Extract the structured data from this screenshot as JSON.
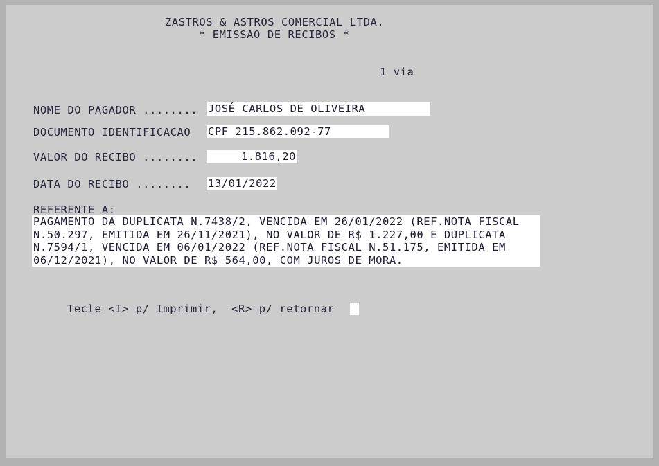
{
  "window": {
    "frame_color": "#b2b2b2",
    "screen_color": "#cccccc",
    "text_color": "#24243c",
    "field_background": "#ffffff"
  },
  "header": {
    "company_title": "ZASTROS & ASTROS COMERCIAL LTDA.",
    "screen_title": "* EMISSAO DE RECIBOS *",
    "via_label": "1 via"
  },
  "form": {
    "fields": [
      {
        "label": "NOME DO PAGADOR ........",
        "value": "JOSÉ CARLOS DE OLIVEIRA",
        "name": "nome-do-pagador"
      },
      {
        "label": "DOCUMENTO IDENTIFICACAO",
        "value": "CPF 215.862.092-77",
        "name": "documento-identificacao"
      },
      {
        "label": "VALOR DO RECIBO ........",
        "value": "1.816,20",
        "name": "valor-do-recibo"
      },
      {
        "label": "DATA DO RECIBO ........",
        "value": "13/01/2022",
        "name": "data-do-recibo"
      }
    ],
    "referente": {
      "label": "REFERENTE A:",
      "value": "PAGAMENTO DA DUPLICATA N.7438/2, VENCIDA EM 26/01/2022 (REF.NOTA FISCAL\nN.50.297, EMITIDA EM 26/11/2021), NO VALOR DE R$ 1.227,00 E DUPLICATA\nN.7594/1, VENCIDA EM 06/01/2022 (REF.NOTA FISCAL N.51.175, EMITIDA EM\n06/12/2021), NO VALOR DE R$ 564,00, COM JUROS DE MORA."
    }
  },
  "footer": {
    "prompt": "Tecle <I> p/ Imprimir,  <R> p/ retornar",
    "cursor": "block-cursor"
  }
}
